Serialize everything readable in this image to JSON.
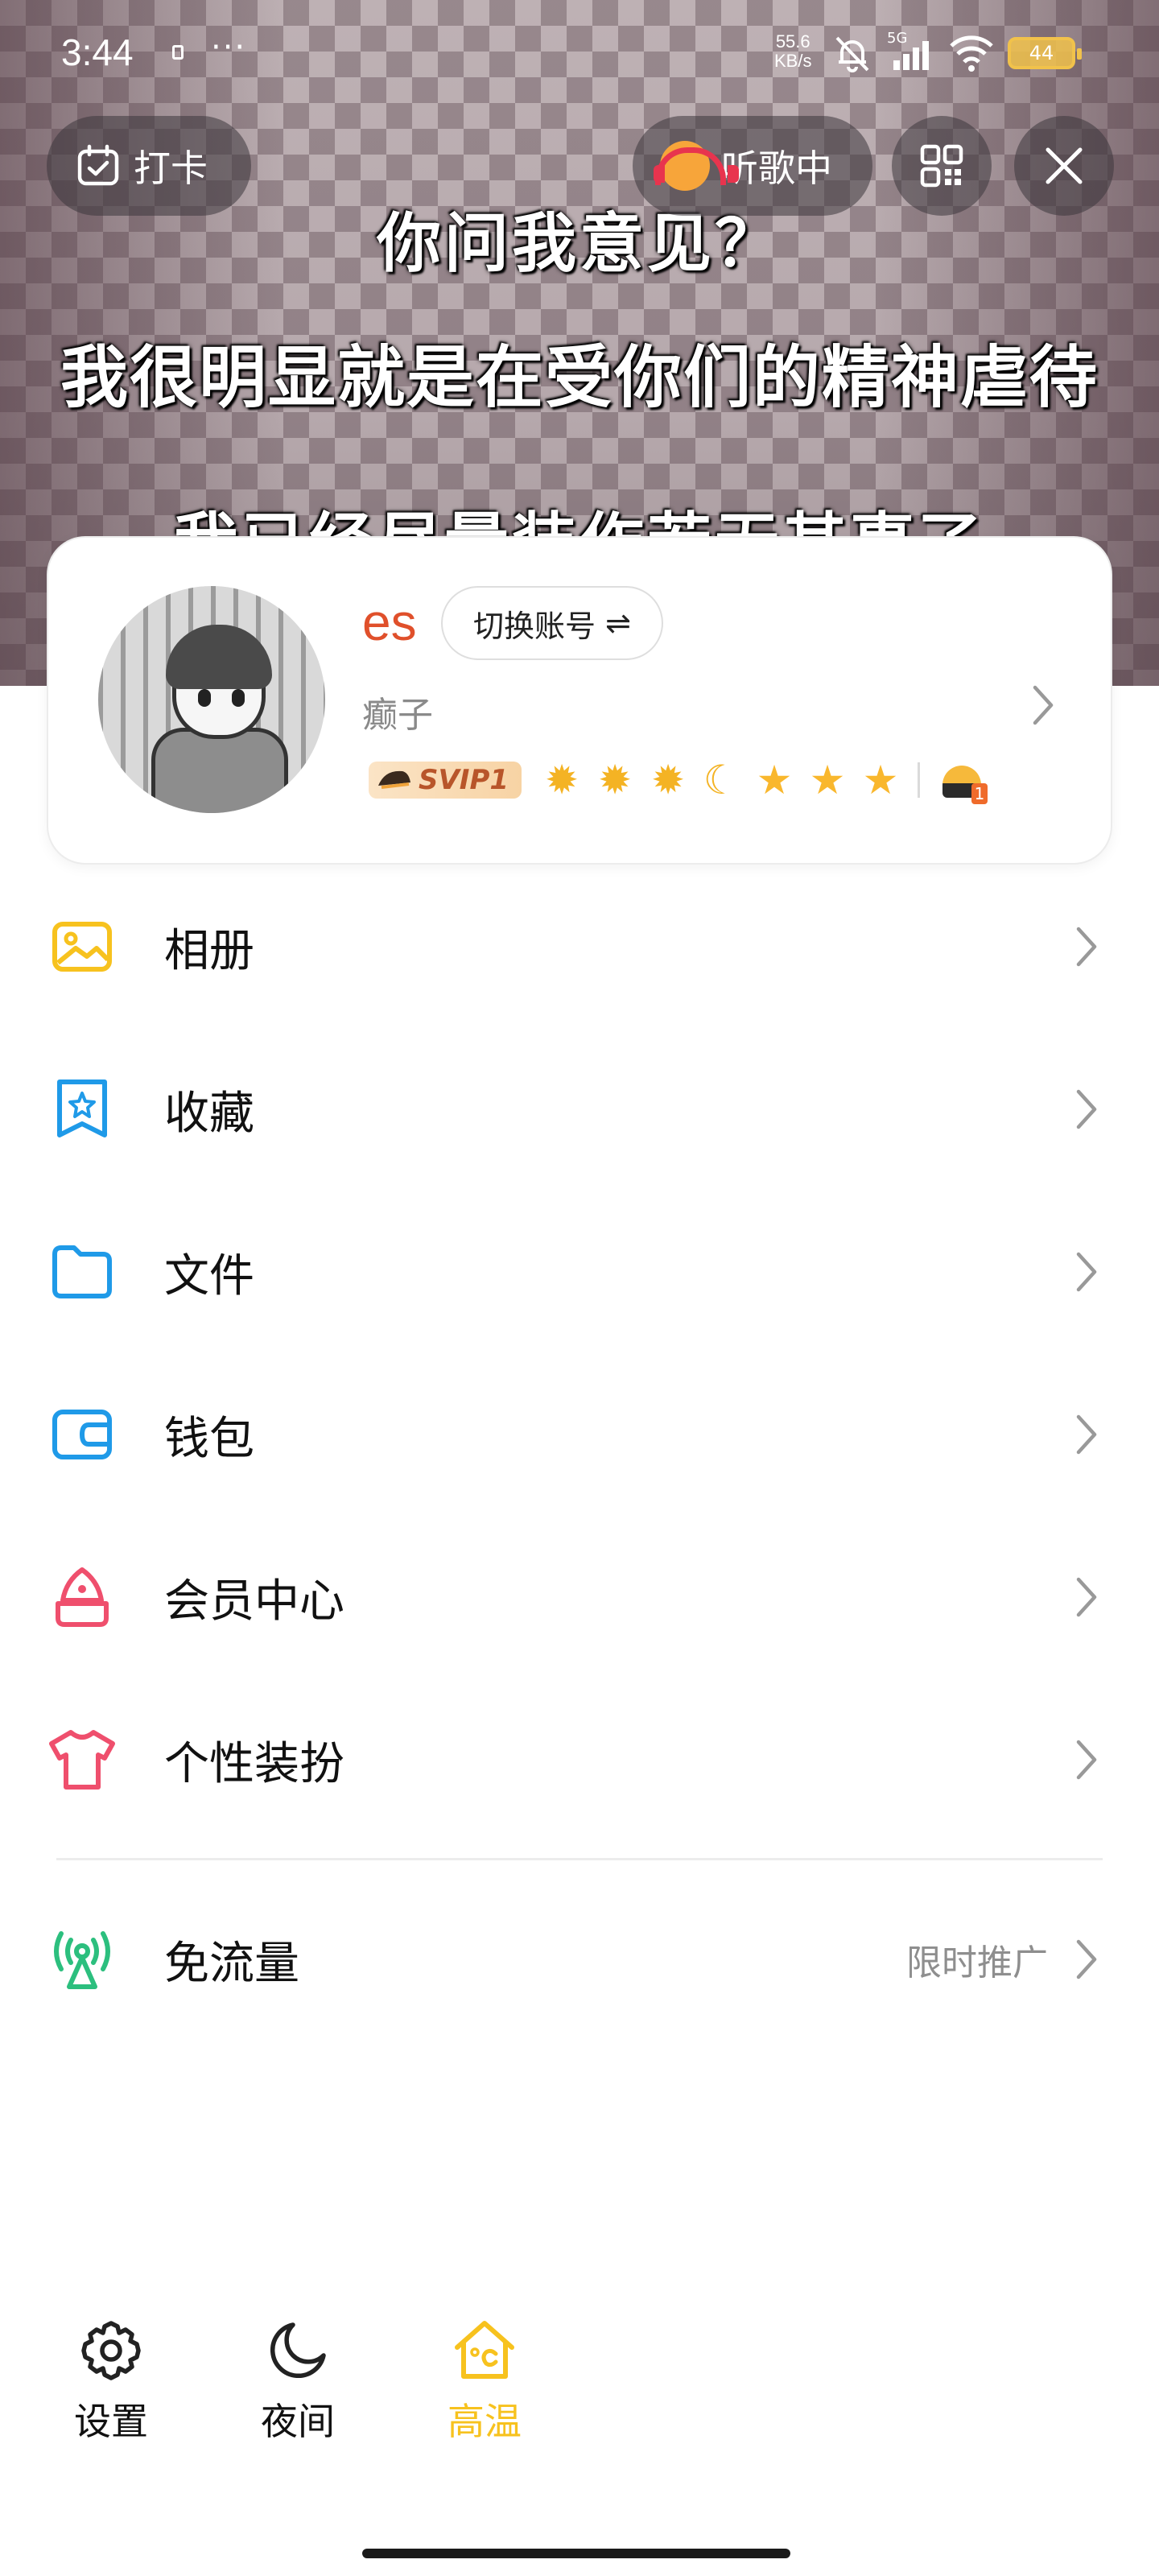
{
  "status_bar": {
    "time": "3:44",
    "more": "···",
    "net_speed_value": "55.6",
    "net_speed_unit": "KB/s",
    "signal_label": "5G",
    "battery": "44",
    "battery_color": "#f1c24b"
  },
  "header": {
    "subtitles": [
      "你问我意见？",
      "我很明显就是在受你们的精神虐待",
      "我已经尽量装作若无其事了"
    ],
    "checkin_label": "打卡",
    "music_label": "听歌中",
    "qr_icon": "qr-code-icon",
    "close_icon": "close-icon"
  },
  "profile": {
    "username": "es",
    "username_color": "#e0502b",
    "switch_account_label": "切换账号",
    "switch_icon": "⇌",
    "nickname": "癫子",
    "vip_label": "SVIP1",
    "level_icons": [
      "sun",
      "sun",
      "sun",
      "moon",
      "star",
      "star",
      "star"
    ],
    "badge_number": "1"
  },
  "menu": [
    {
      "label": "相册",
      "icon": "photo-album-icon",
      "color": "#f7c21e"
    },
    {
      "label": "收藏",
      "icon": "favorites-icon",
      "color": "#1f9ae8"
    },
    {
      "label": "文件",
      "icon": "folder-icon",
      "color": "#1f9ae8"
    },
    {
      "label": "钱包",
      "icon": "wallet-icon",
      "color": "#1f9ae8"
    },
    {
      "label": "会员中心",
      "icon": "vip-center-icon",
      "color": "#ef4f6d"
    },
    {
      "label": "个性装扮",
      "icon": "tshirt-icon",
      "color": "#ef4f6d"
    }
  ],
  "free_data": {
    "label": "免流量",
    "extra": "限时推广",
    "icon": "antenna-icon",
    "color": "#2cbf7e"
  },
  "bottom_bar": {
    "settings_label": "设置",
    "night_label": "夜间",
    "temp_label": "高温",
    "temp_color": "#f7c21e"
  }
}
